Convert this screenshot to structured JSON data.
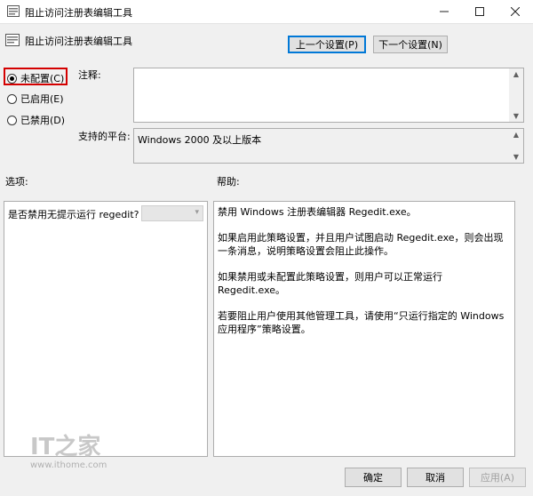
{
  "window": {
    "title": "阻止访问注册表编辑工具",
    "controls": [
      "minimize",
      "maximize",
      "close"
    ]
  },
  "header": {
    "policy_name": "阻止访问注册表编辑工具",
    "prev_button": "上一个设置(P)",
    "next_button": "下一个设置(N)"
  },
  "state": {
    "options": [
      {
        "label": "未配置(C)",
        "selected": true
      },
      {
        "label": "已启用(E)",
        "selected": false
      },
      {
        "label": "已禁用(D)",
        "selected": false
      }
    ]
  },
  "comment": {
    "label": "注释:",
    "value": ""
  },
  "platform": {
    "label": "支持的平台:",
    "value": "Windows 2000 及以上版本"
  },
  "options_panel": {
    "label": "选项:",
    "item_label": "是否禁用无提示运行 regedit?",
    "dropdown_value": ""
  },
  "help_panel": {
    "label": "帮助:",
    "paragraphs": [
      "禁用 Windows 注册表编辑器 Regedit.exe。",
      "如果启用此策略设置，并且用户试图启动 Regedit.exe，则会出现一条消息，说明策略设置会阻止此操作。",
      "如果禁用或未配置此策略设置，则用户可以正常运行 Regedit.exe。",
      "若要阻止用户使用其他管理工具，请使用“只运行指定的 Windows 应用程序”策略设置。"
    ]
  },
  "watermark": {
    "logo": "IT之家",
    "url": "www.ithome.com"
  },
  "footer": {
    "ok": "确定",
    "cancel": "取消",
    "apply": "应用(A)"
  },
  "colors": {
    "highlight_box": "#d40000",
    "accent": "#0078d7"
  }
}
